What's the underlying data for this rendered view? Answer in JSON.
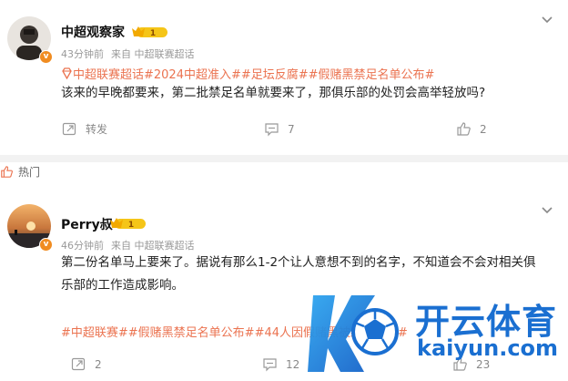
{
  "post1": {
    "username": "中超观察家",
    "level": "1",
    "time": "43分钟前",
    "source": "来自 中超联赛超话",
    "tags": "中超联赛超话#2024中超准入##足坛反腐##假赌黑禁足名单公布#",
    "text": "该来的早晚都要来，第二批禁足名单就要来了，那俱乐部的处罚会高举轻放吗?",
    "repost_label": "转发",
    "comment_count": "7",
    "like_count": "2"
  },
  "hot_label": "热门",
  "post2": {
    "username": "Perry叔",
    "level": "1",
    "time": "46分钟前",
    "source": "来自 中超联赛超话",
    "text_line1": "第二份名单马上要来了。据说有那么1-2个让人意想不到的名字，不知道会不会对相关俱",
    "text_line2": "乐部的工作造成影响。",
    "tags": "#中超联赛##假赌黑禁足名单公布##44人因假赌黑被终身禁足#",
    "repost_count": "2",
    "comment_count": "12",
    "like_count": "23"
  },
  "watermark": {
    "brand": "开云体育",
    "domain": "kaiyun.com"
  },
  "colors": {
    "tag": "#eb7350",
    "badge": "#f08c21",
    "brand_blue": "#1a6fd1",
    "divider": "#f2f2f2"
  }
}
